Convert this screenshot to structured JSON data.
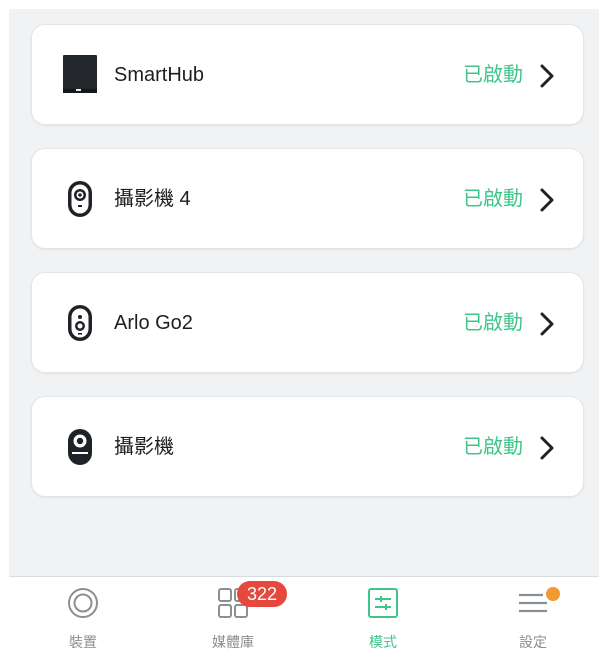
{
  "devices": [
    {
      "name": "SmartHub",
      "status": "已啟動",
      "icon": "smarthub-icon"
    },
    {
      "name": "攝影機 4",
      "status": "已啟動",
      "icon": "camera-icon"
    },
    {
      "name": "Arlo Go2",
      "status": "已啟動",
      "icon": "arlo-go-camera-icon"
    },
    {
      "name": "攝影機",
      "status": "已啟動",
      "icon": "camera-icon"
    }
  ],
  "tabs": [
    {
      "label": "裝置",
      "icon": "devices-icon"
    },
    {
      "label": "媒體庫",
      "icon": "library-icon",
      "badge": "322"
    },
    {
      "label": "模式",
      "icon": "modes-icon"
    },
    {
      "label": "設定",
      "icon": "settings-menu-icon"
    }
  ],
  "active_tab": "模式",
  "colors": {
    "accent": "#3fc48a",
    "badge": "#e6483d",
    "notification_dot": "#f29a32",
    "background": "#f1f2f3"
  }
}
